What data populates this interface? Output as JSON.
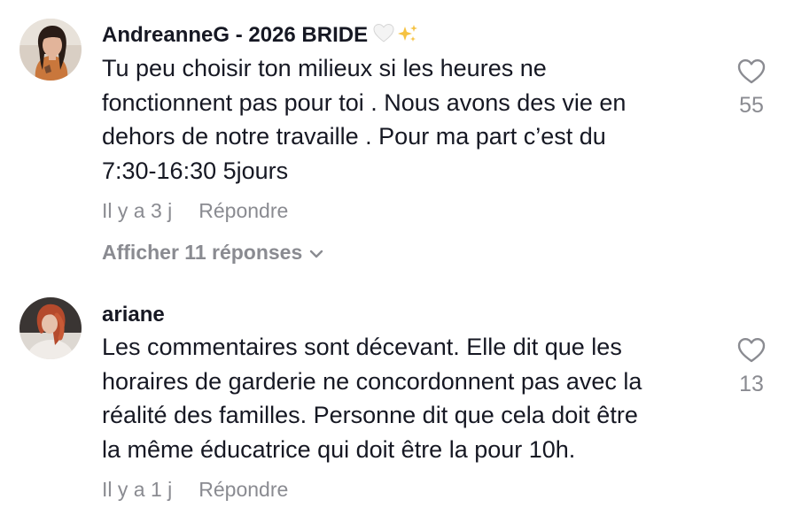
{
  "comments": [
    {
      "username": "AndreanneG - 2026 BRIDE",
      "username_emoji": "white-heart-and-sparkles",
      "text_lines": [
        "Tu peu choisir ton milieux si les heures ne",
        "fonctionnent pas pour toi . Nous avons des vie en",
        "dehors de notre travaille . Pour ma part c’est du",
        "7:30-16:30 5jours"
      ],
      "timestamp": "Il y a 3 j",
      "reply_label": "Répondre",
      "view_replies_label": "Afficher 11 réponses",
      "like_count": "55",
      "avatar_icon": "user-avatar-photo"
    },
    {
      "username": "ariane",
      "text_lines": [
        "Les commentaires sont décevant. Elle dit que les",
        "horaires de garderie ne concordonnent pas avec la",
        "réalité des familles. Personne dit que cela doit être",
        "la même éducatrice qui doit être la pour 10h."
      ],
      "timestamp": "Il y a 1 j",
      "reply_label": "Répondre",
      "like_count": "13",
      "avatar_icon": "user-avatar-photo"
    }
  ],
  "colors": {
    "text_primary": "#161823",
    "text_secondary": "#8a8b91",
    "icon_gray": "#8a8b91"
  }
}
